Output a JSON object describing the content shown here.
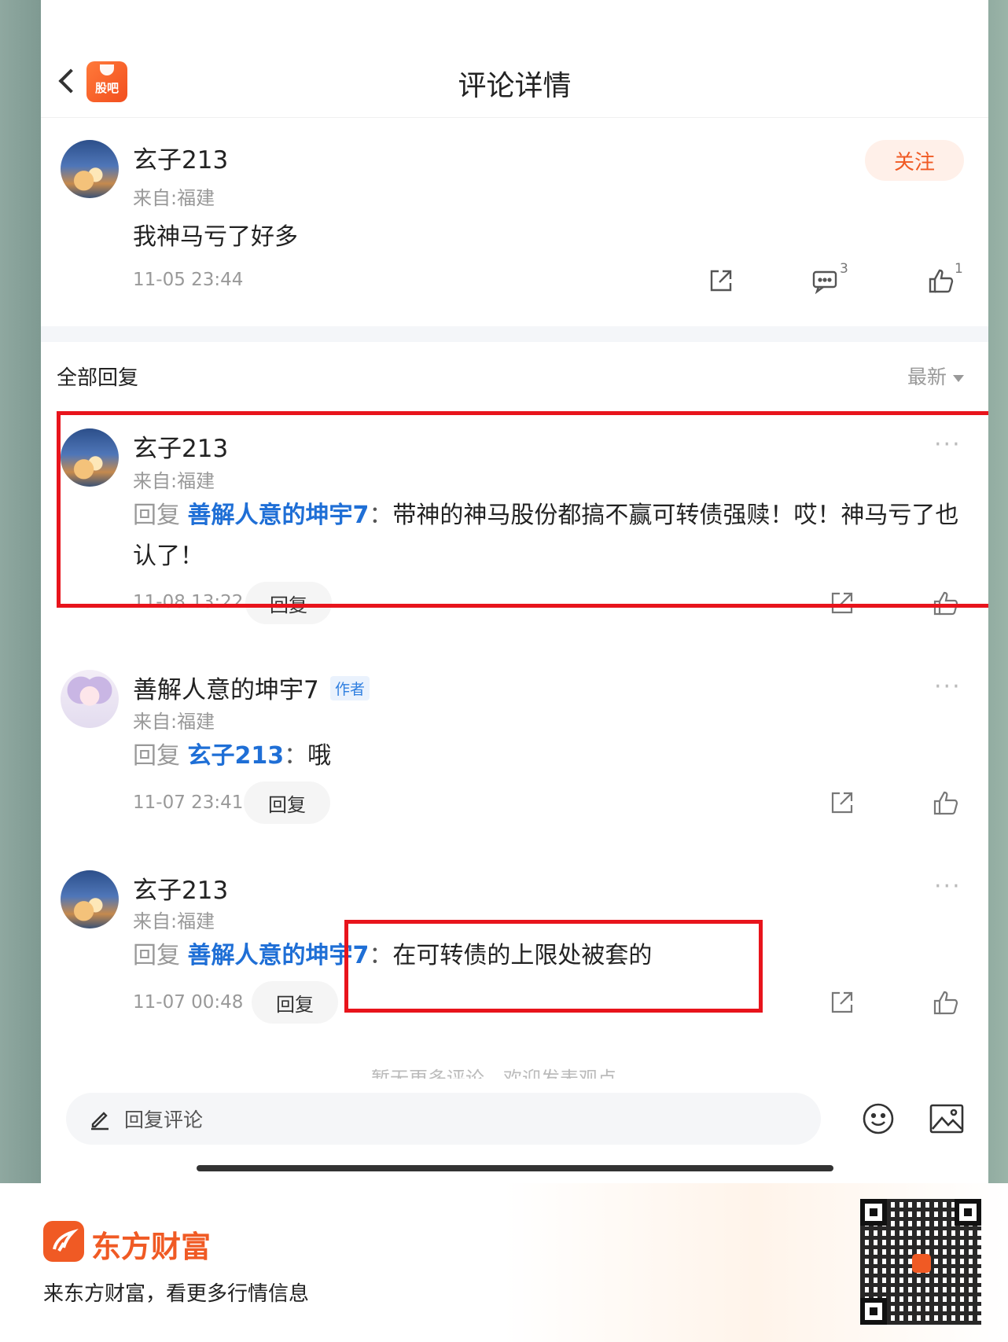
{
  "header": {
    "title": "评论详情",
    "logo_text": "股吧"
  },
  "main_comment": {
    "username": "玄子213",
    "location": "来自:福建",
    "follow_label": "关注",
    "text": "我神马亏了好多",
    "time": "11-05 23:44",
    "comment_count": "3",
    "like_count": "1"
  },
  "replies_header": {
    "title": "全部回复",
    "sort_label": "最新"
  },
  "replies": [
    {
      "username": "玄子213",
      "location": "来自:福建",
      "prefix": "回复",
      "target": "善解人意的坤宇7",
      "colon": "：",
      "text": "带神的神马股份都搞不赢可转债强赎！哎！神马亏了也认了！",
      "time": "11-08 13:22",
      "reply_label": "回复"
    },
    {
      "username": "善解人意的坤宇7",
      "badge": "作者",
      "location": "来自:福建",
      "prefix": "回复",
      "target": "玄子213",
      "colon": "：",
      "text": "哦",
      "time": "11-07 23:41",
      "reply_label": "回复"
    },
    {
      "username": "玄子213",
      "location": "来自:福建",
      "prefix": "回复",
      "target": "善解人意的坤宇7",
      "colon": "：",
      "text": "在可转债的上限处被套的",
      "time": "11-07 00:48",
      "reply_label": "回复"
    }
  ],
  "cutoff_text": "暂无更多评论，欢迎发表观点",
  "bottom_bar": {
    "placeholder": "回复评论"
  },
  "footer": {
    "brand": "东方财富",
    "slogan": "来东方财富，看更多行情信息"
  },
  "colors": {
    "accent": "#f05a24",
    "link": "#1f6fd6",
    "highlight_box": "#e8141c"
  }
}
